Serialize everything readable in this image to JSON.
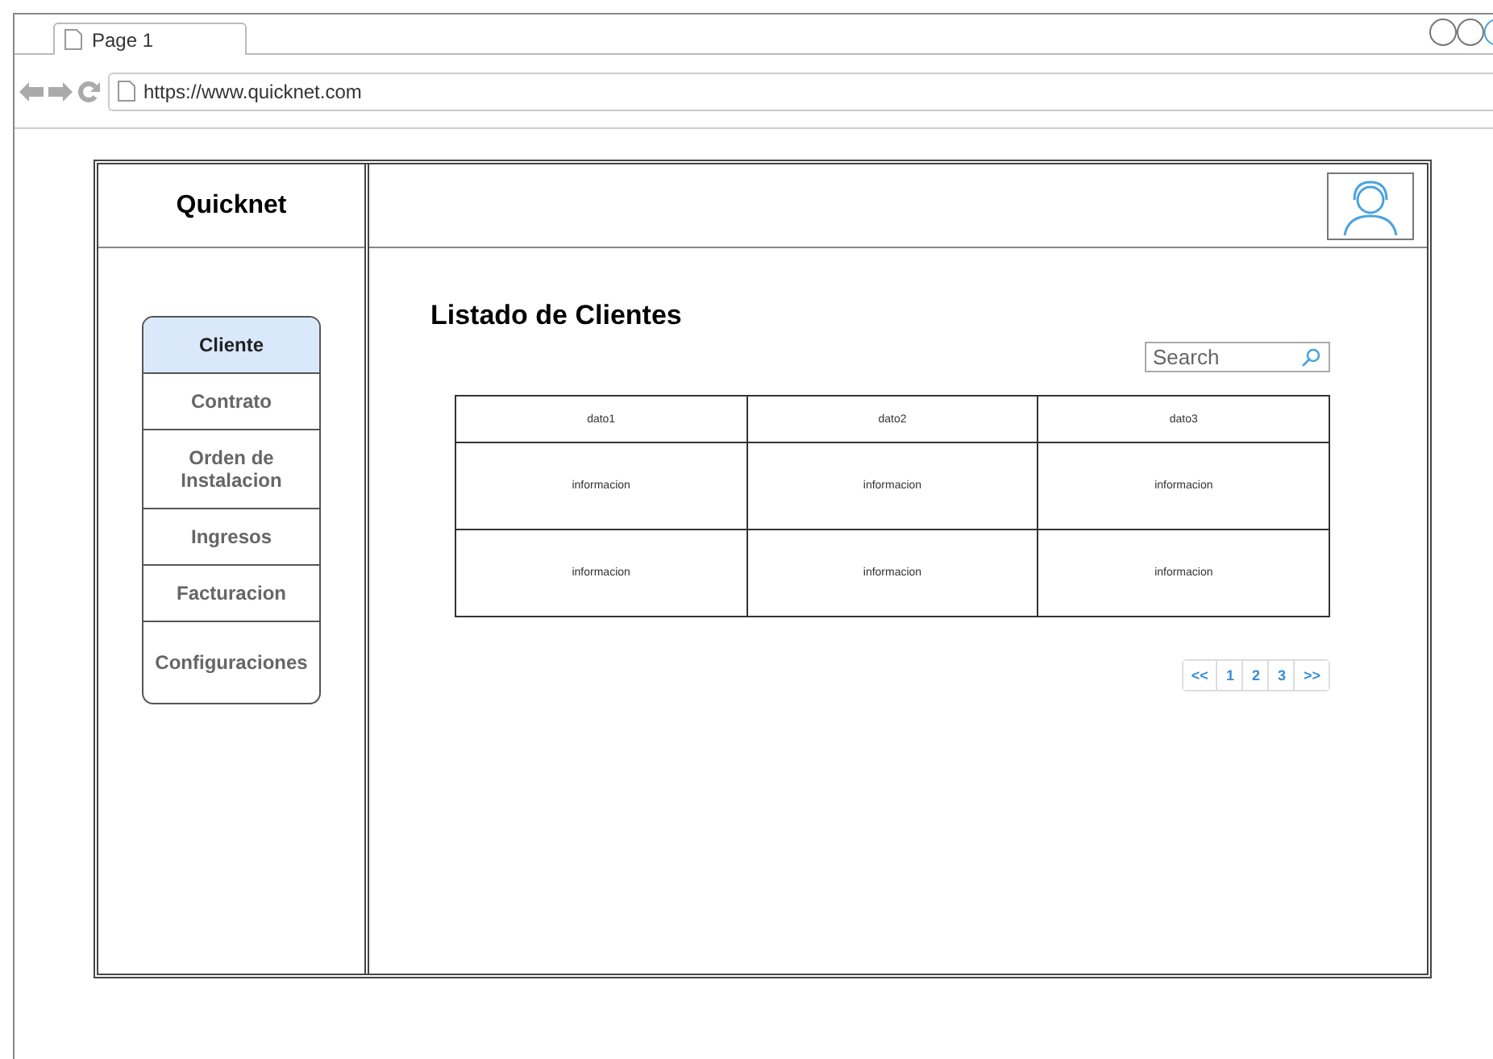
{
  "browser": {
    "tab": "Page 1",
    "url": "https://www.quicknet.com"
  },
  "sidebar": {
    "brand": "Quicknet",
    "items": [
      {
        "label": "Cliente",
        "selected": true
      },
      {
        "label": "Contrato",
        "selected": false
      },
      {
        "label": "Orden de Instalacion",
        "selected": false
      },
      {
        "label": "Ingresos",
        "selected": false
      },
      {
        "label": "Facturacion",
        "selected": false
      },
      {
        "label": "Configuraciones",
        "selected": false
      }
    ]
  },
  "main": {
    "title": "Listado de Clientes",
    "search": {
      "placeholder": "Search"
    },
    "table": {
      "columns": [
        "dato1",
        "dato2",
        "dato3"
      ],
      "rows": [
        [
          "informacion",
          "informacion",
          "informacion"
        ],
        [
          "informacion",
          "informacion",
          "informacion"
        ]
      ]
    },
    "pagination": [
      "<<",
      "1",
      "2",
      "3",
      ">>"
    ]
  }
}
